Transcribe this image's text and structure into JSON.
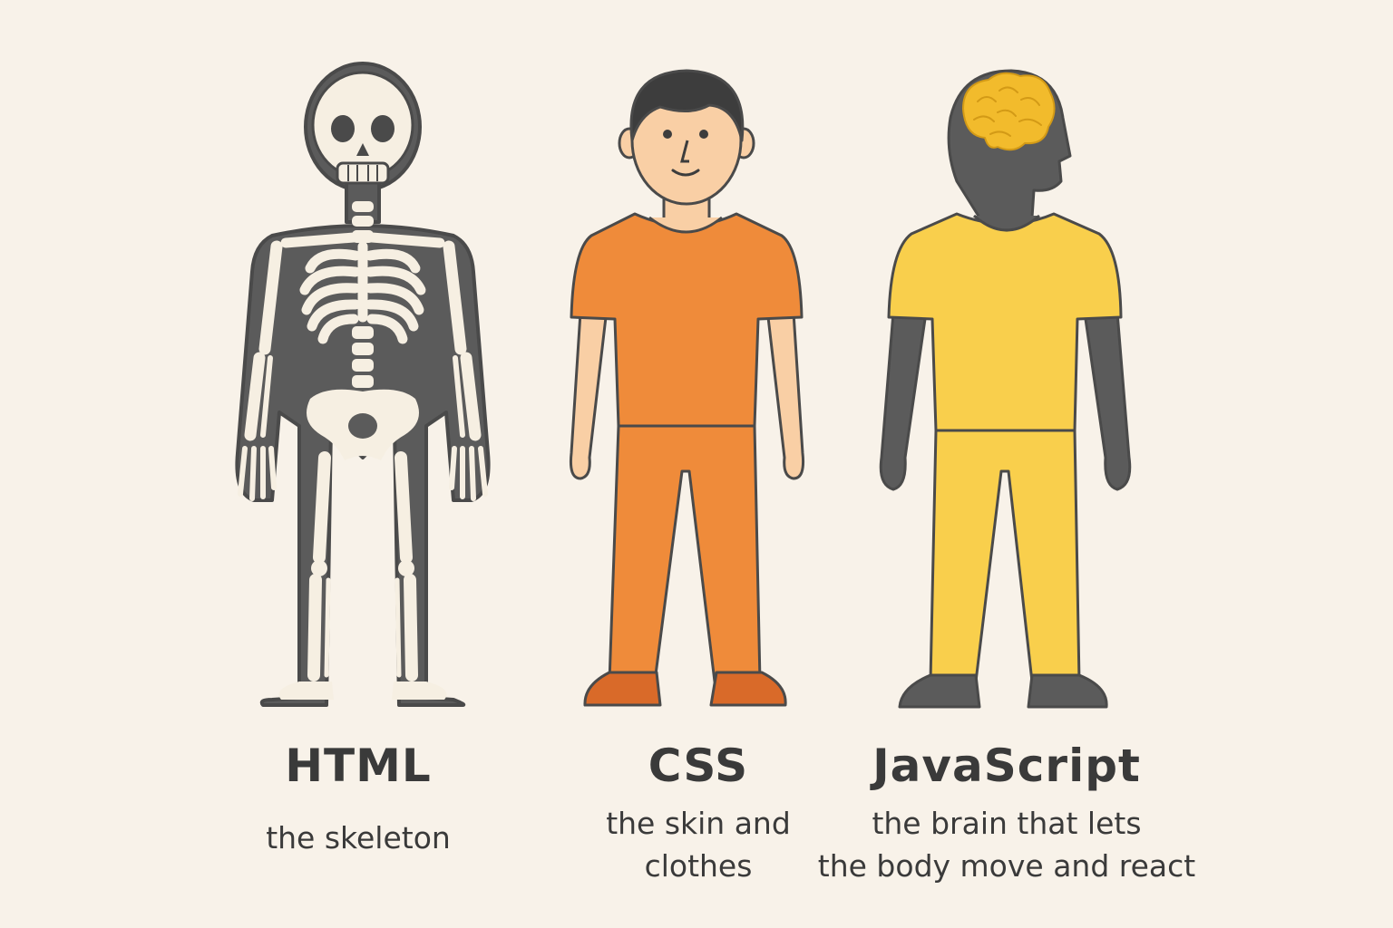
{
  "panels": [
    {
      "title": "HTML",
      "caption_lines": [
        "the skeleton"
      ]
    },
    {
      "title": "CSS",
      "caption_lines": [
        "the skin and",
        "clothes"
      ]
    },
    {
      "title": "JavaScript",
      "caption_lines": [
        "the brain that lets",
        "the body move and react"
      ]
    }
  ],
  "colors": {
    "background": "#f8f2e9",
    "outline": "#4a4a4a",
    "body_dark": "#5b5b5b",
    "bone": "#f6efe2",
    "skin": "#f9cfa5",
    "css_clothes": "#ef8b3a",
    "css_shoes": "#d96a29",
    "js_clothes": "#f9cf4c",
    "brain": "#f2bb2c",
    "text": "#3a3a3a"
  },
  "icons": [
    "skeleton-figure",
    "clothed-person-figure",
    "brain-silhouette-figure"
  ]
}
